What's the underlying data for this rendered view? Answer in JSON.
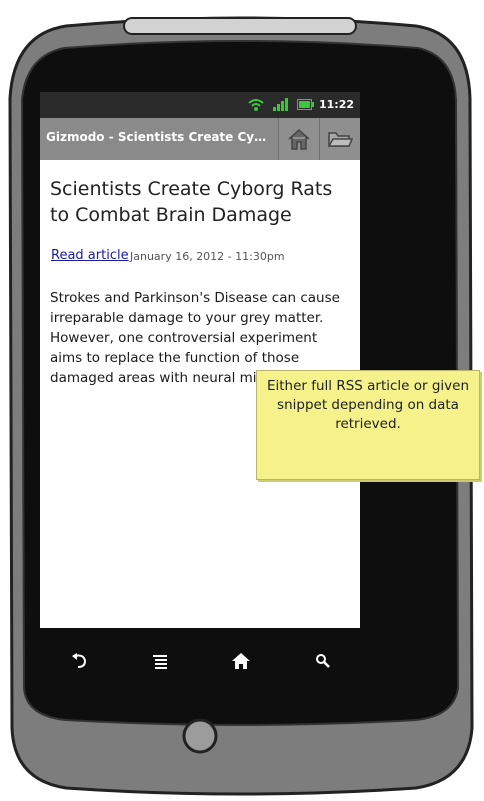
{
  "status_bar": {
    "time": "11:22",
    "wifi_icon": "wifi-icon",
    "signal_icon": "signal-icon",
    "battery_icon": "battery-icon"
  },
  "action_bar": {
    "title": "Gizmodo - Scientists Create Cyborg Rats to Combat Brain Damage",
    "home_icon": "home-icon",
    "folder_icon": "folder-icon"
  },
  "article": {
    "title": "Scientists Create Cyborg Rats to Combat Brain Damage",
    "read_link": "Read article",
    "date": "January 16, 2012 - 11:30pm",
    "body": "Strokes and Parkinson's Disease can cause irreparable damage to your grey matter. However, one controversial experiment aims to replace the function of those damaged areas with neural microchips."
  },
  "note": {
    "text": "Either full RSS article or given snippet depending on data retrieved."
  },
  "nav_bar": {
    "icons": [
      "back-icon",
      "menu-icon",
      "home-icon",
      "search-icon"
    ]
  },
  "colors": {
    "accent_green": "#39c83a",
    "action_bar": "#8a8a8a",
    "note_yellow": "#f5f28c",
    "link": "#1a1aa8"
  }
}
